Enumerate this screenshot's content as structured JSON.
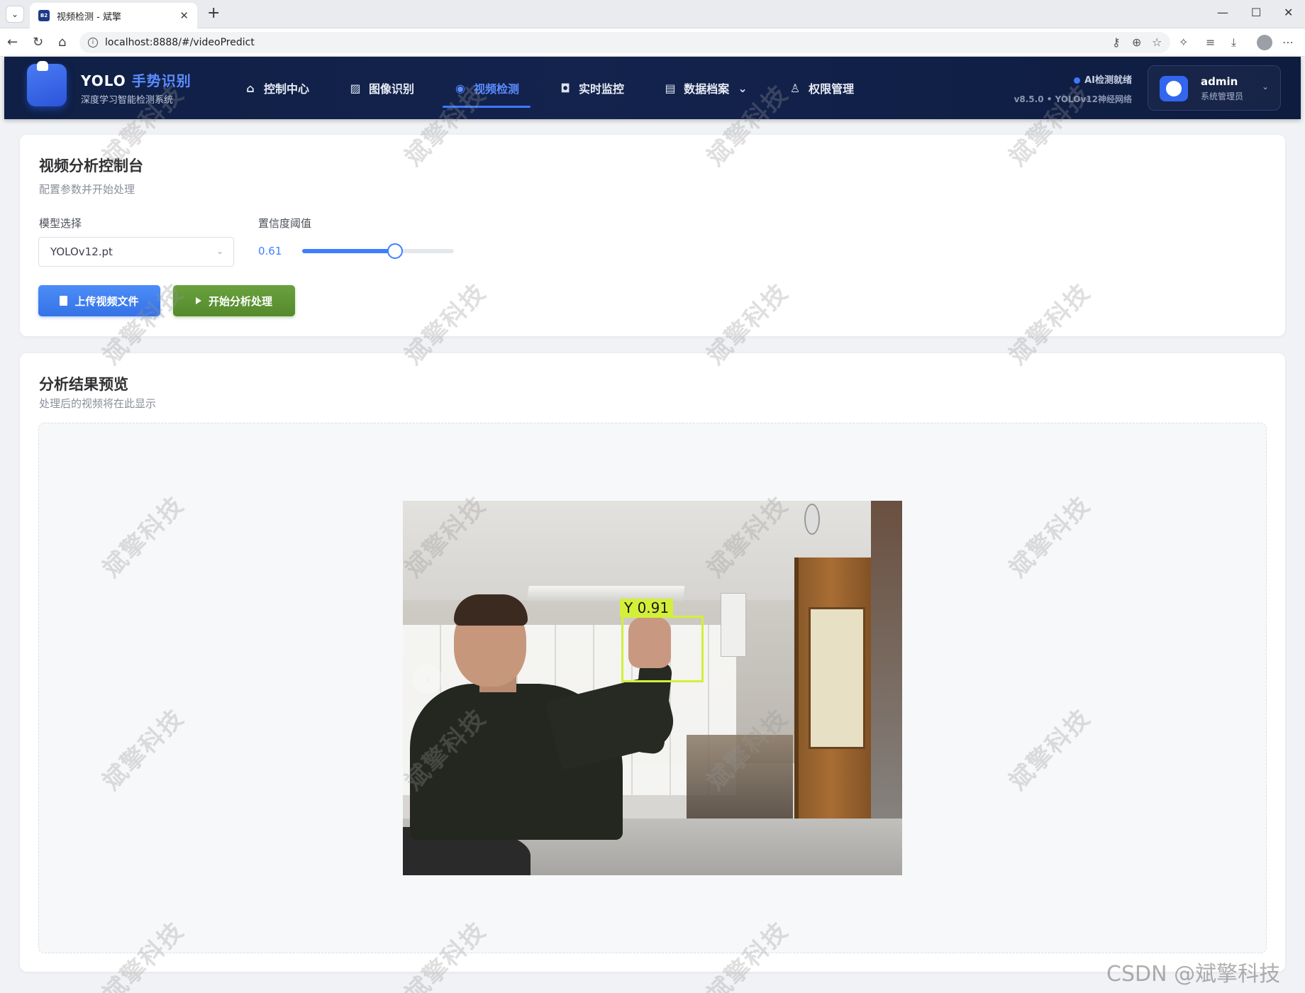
{
  "browser": {
    "tab_title": "视频检测 - 斌擎",
    "tab_favicon_text": "B2",
    "url": "localhost:8888/#/videoPredict"
  },
  "header": {
    "brand_prefix": "YOLO",
    "brand_accent": "手势识别",
    "brand_subtitle": "深度学习智能检测系统",
    "nav": [
      {
        "label": "控制中心",
        "icon": "home-icon"
      },
      {
        "label": "图像识别",
        "icon": "image-icon"
      },
      {
        "label": "视频检测",
        "icon": "play-circle-icon",
        "active": true
      },
      {
        "label": "实时监控",
        "icon": "camera-icon"
      },
      {
        "label": "数据档案",
        "icon": "document-icon",
        "has_dropdown": true
      },
      {
        "label": "权限管理",
        "icon": "user-icon"
      }
    ],
    "status": "AI检测就绪",
    "version": "v8.5.0 • YOLOv12神经网络",
    "user": {
      "name": "admin",
      "role": "系统管理员"
    }
  },
  "control_card": {
    "title": "视频分析控制台",
    "subtitle": "配置参数并开始处理",
    "model_label": "模型选择",
    "model_value": "YOLOv12.pt",
    "confidence_label": "置信度阈值",
    "confidence_value": "0.61",
    "confidence_fraction": 0.61,
    "upload_button": "上传视频文件",
    "start_button": "开始分析处理"
  },
  "result_card": {
    "title": "分析结果预览",
    "subtitle": "处理后的视频将在此显示",
    "detection_label": "Y 0.91"
  },
  "watermark": "斌擎科技",
  "csdn_watermark": "CSDN @斌擎科技",
  "colors": {
    "accent": "#3f7fff",
    "upload_button": "#3472e6",
    "start_button": "#548a2c",
    "detection_box": "#d4ef3a",
    "header_bg": "#0f1f45"
  }
}
